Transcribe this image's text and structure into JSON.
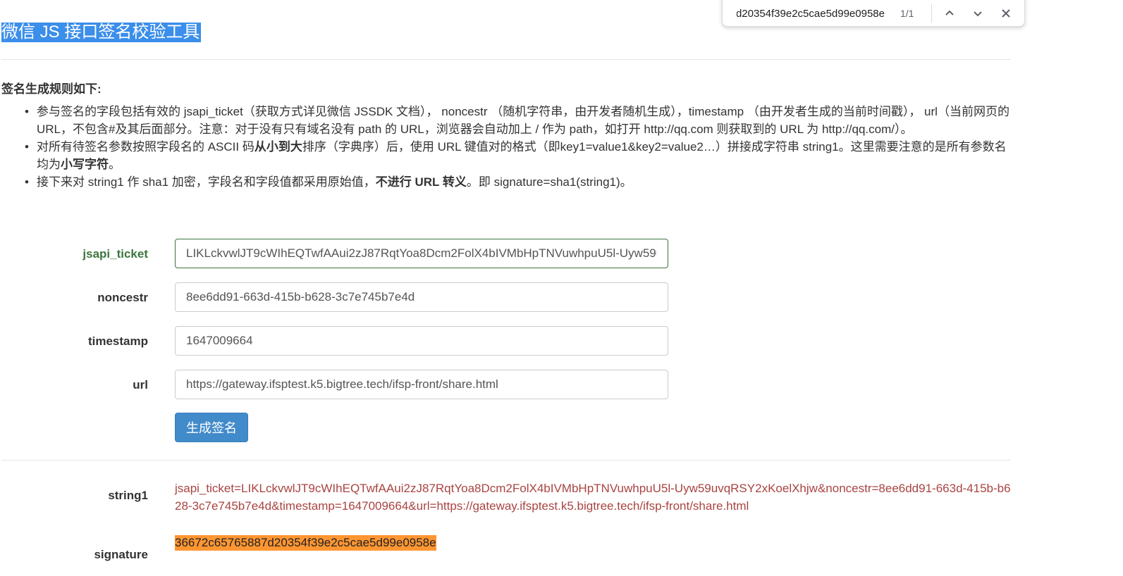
{
  "find_bar": {
    "query": "36672c65765887d20354f39e2c5cae5d99e0958e",
    "count": "1/1",
    "prev_icon": "chevron-up-icon",
    "next_icon": "chevron-down-icon",
    "close_icon": "close-icon"
  },
  "page": {
    "title": "微信 JS 接口签名校验工具",
    "rules_heading": "签名生成规则如下:",
    "rules": [
      {
        "parts": [
          "参与签名的字段包括有效的 jsapi_ticket（获取方式详见微信 JSSDK 文档）， noncestr （随机字符串，由开发者随机生成），timestamp （由开发者生成的当前时间戳）， url（当前网页的URL，不包含#及其后面部分。注意：对于没有只有域名没有 path 的 URL，浏览器会自动加上 / 作为 path，如打开 http://qq.com 则获取到的 URL 为 http://qq.com/）。"
        ]
      },
      {
        "parts": [
          "对所有待签名参数按照字段名的 ASCII 码",
          "从小到大",
          "排序（字典序）后，使用 URL 键值对的格式（即key1=value1&key2=value2…）拼接成字符串 string1。这里需要注意的是所有参数名均为",
          "小写字符",
          "。"
        ]
      },
      {
        "parts": [
          "接下来对 string1 作 sha1 加密，字段名和字段值都采用原始值，",
          "不进行 URL 转义",
          "。即 signature=sha1(string1)。"
        ]
      }
    ]
  },
  "form": {
    "jsapi_ticket_label": "jsapi_ticket",
    "jsapi_ticket_value": "LIKLckvwlJT9cWIhEQTwfAAui2zJ87RqtYoa8Dcm2FolX4bIVMbHpTNVuwhpuU5l-Uyw59uvqRSY2xKoelXhjw",
    "noncestr_label": "noncestr",
    "noncestr_value": "8ee6dd91-663d-415b-b628-3c7e745b7e4d",
    "timestamp_label": "timestamp",
    "timestamp_value": "1647009664",
    "url_label": "url",
    "url_value": "https://gateway.ifsptest.k5.bigtree.tech/ifsp-front/share.html",
    "submit_label": "生成签名"
  },
  "result": {
    "string1_label": "string1",
    "string1_value": "jsapi_ticket=LIKLckvwlJT9cWIhEQTwfAAui2zJ87RqtYoa8Dcm2FolX4bIVMbHpTNVuwhpuU5l-Uyw59uvqRSY2xKoelXhjw&noncestr=8ee6dd91-663d-415b-b628-3c7e745b7e4d&timestamp=1647009664&url=https://gateway.ifsptest.k5.bigtree.tech/ifsp-front/share.html",
    "signature_label": "signature",
    "signature_value": "36672c65765887d20354f39e2c5cae5d99e0958e"
  },
  "colors": {
    "title_highlight": "#3b8eea",
    "success_green": "#3c763d",
    "button_blue": "#428bca",
    "error_red": "#a94442",
    "find_match_orange": "#ff9632"
  }
}
